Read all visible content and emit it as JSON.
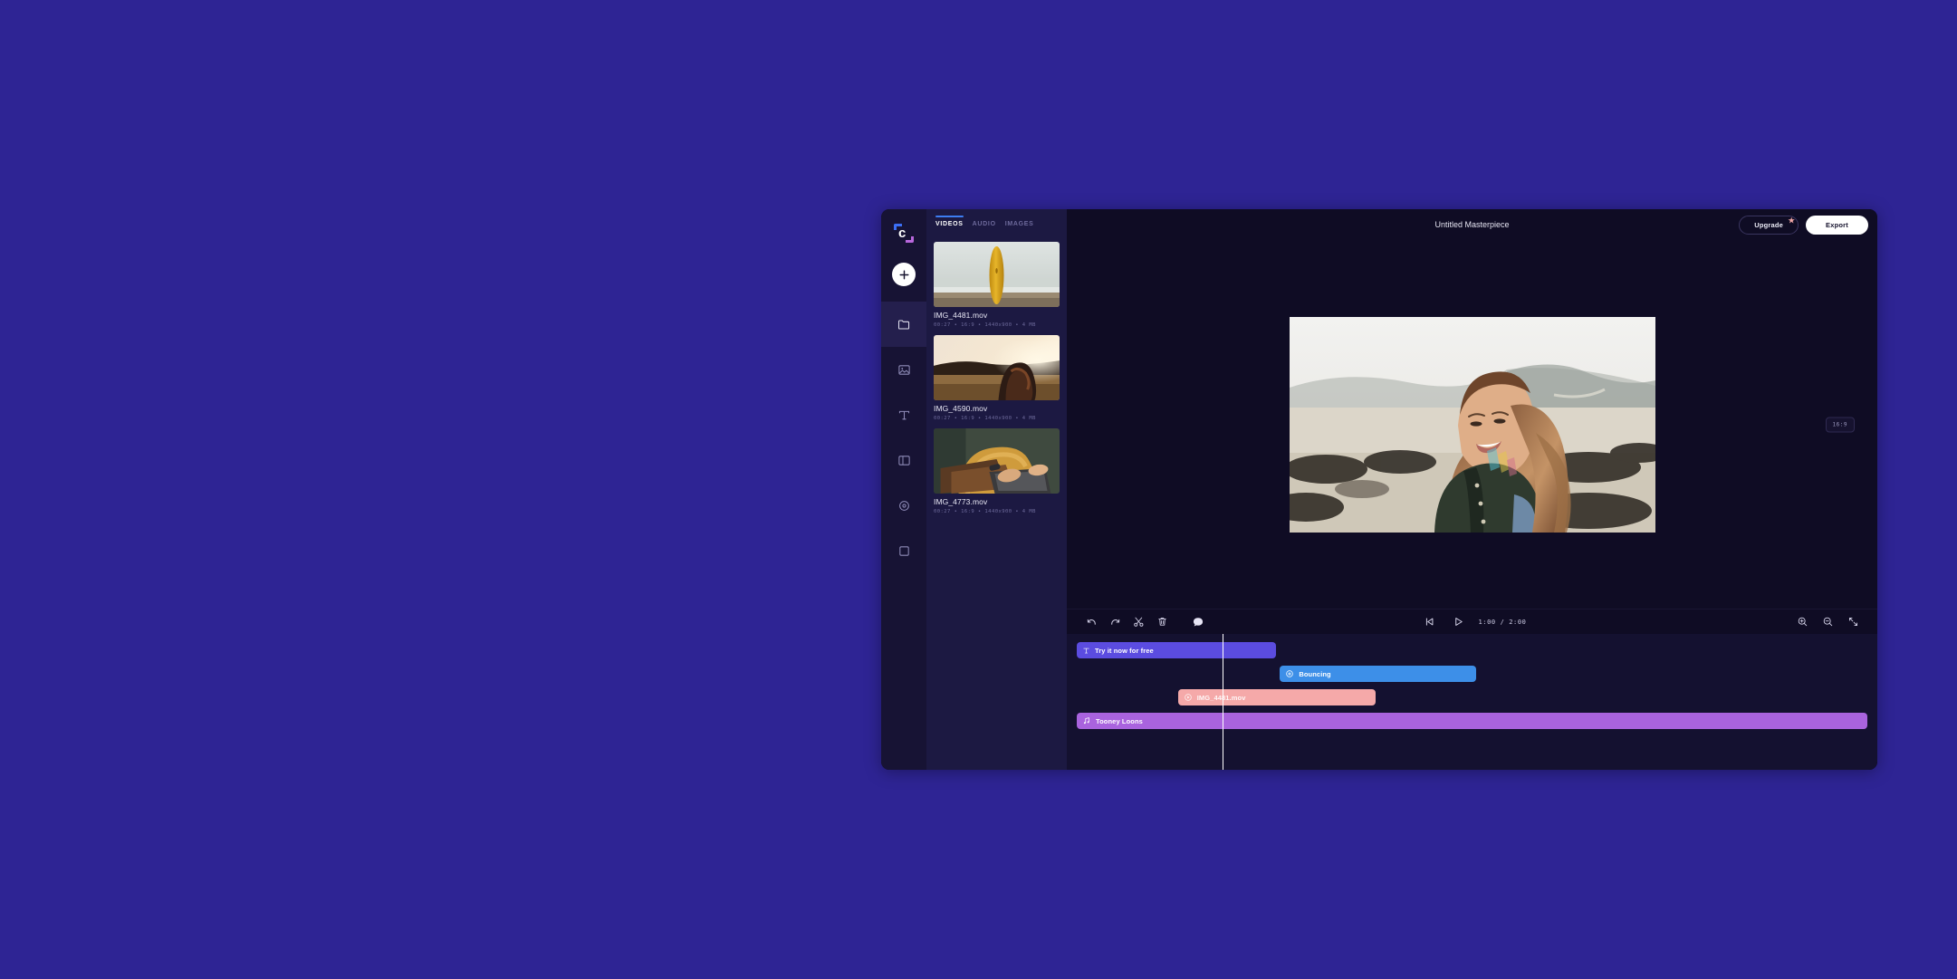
{
  "app": {
    "name": "Clipchamp",
    "logo_icon": "clipchamp-logo-icon",
    "background_color": "#2e2494",
    "window_color": "#0f0c24"
  },
  "rail": {
    "add_button": {
      "icon": "plus-icon",
      "label": "Add media"
    },
    "items": [
      {
        "icon": "folder-icon",
        "name": "your-media",
        "active": true
      },
      {
        "icon": "image-icon",
        "name": "stock-media",
        "active": false
      },
      {
        "icon": "text-icon",
        "name": "text",
        "active": false
      },
      {
        "icon": "layout-icon",
        "name": "transitions",
        "active": false
      },
      {
        "icon": "record-icon",
        "name": "record",
        "active": false
      },
      {
        "icon": "square-icon",
        "name": "brand-kit",
        "active": false
      }
    ]
  },
  "media_panel": {
    "tabs": [
      {
        "label": "VIDEOS",
        "active": true
      },
      {
        "label": "AUDIO",
        "active": false
      },
      {
        "label": "IMAGES",
        "active": false
      }
    ],
    "items": [
      {
        "name": "IMG_4481.mov",
        "meta": "00:27  •  16:9  •  1440x900  •  4 MB",
        "thumb": "surfboard-beach-thumbnail"
      },
      {
        "name": "IMG_4590.mov",
        "meta": "00:27  •  16:9  •  1440x900  •  4 MB",
        "thumb": "sunset-field-thumbnail"
      },
      {
        "name": "IMG_4773.mov",
        "meta": "00:27  •  16:9  •  1440x900  •  4 MB",
        "thumb": "laptop-typing-thumbnail"
      }
    ]
  },
  "topbar": {
    "title": "Untitled Masterpiece",
    "upgrade_label": "Upgrade",
    "upgrade_badge_icon": "star-icon",
    "upgrade_badge_color": "#f3a7a7",
    "export_label": "Export"
  },
  "preview": {
    "ratio_badge": "16:9",
    "frame_description": "smiling-woman-outdoors-preview"
  },
  "timeline_toolbar": {
    "left_icons": [
      {
        "icon": "undo-icon",
        "name": "undo-button"
      },
      {
        "icon": "redo-icon",
        "name": "redo-button"
      },
      {
        "icon": "scissors-icon",
        "name": "split-button"
      },
      {
        "icon": "trash-icon",
        "name": "delete-button"
      },
      {
        "icon": "comment-icon",
        "name": "comment-button"
      }
    ],
    "transport": [
      {
        "icon": "skip-start-icon",
        "name": "skip-to-start-button"
      },
      {
        "icon": "play-icon",
        "name": "play-button"
      }
    ],
    "current_time": "1:00",
    "total_time": "2:00",
    "time_separator": "/",
    "right_icons": [
      {
        "icon": "zoom-in-icon",
        "name": "zoom-in-button"
      },
      {
        "icon": "zoom-out-icon",
        "name": "zoom-out-button"
      },
      {
        "icon": "fit-screen-icon",
        "name": "fit-to-screen-button"
      }
    ]
  },
  "timeline": {
    "playhead_position_pct": 19.2,
    "clips": [
      {
        "label": "Try it now for free",
        "icon": "text-t-icon",
        "color": "#5b4ce0",
        "left_pct": 0,
        "width_pct": 25.2,
        "track": 0
      },
      {
        "label": "Bouncing",
        "icon": "target-icon",
        "color": "#3d8fe8",
        "left_pct": 25.7,
        "width_pct": 24.8,
        "track": 1
      },
      {
        "label": "IMG_4481.mov",
        "icon": "play-circle-icon",
        "color": "#f5a9a9",
        "left_pct": 12.8,
        "width_pct": 25.0,
        "track": 2
      },
      {
        "label": "Tooney Loons",
        "icon": "music-note-icon",
        "color": "#a963de",
        "left_pct": 0,
        "width_pct": 100,
        "track": 3
      }
    ]
  }
}
